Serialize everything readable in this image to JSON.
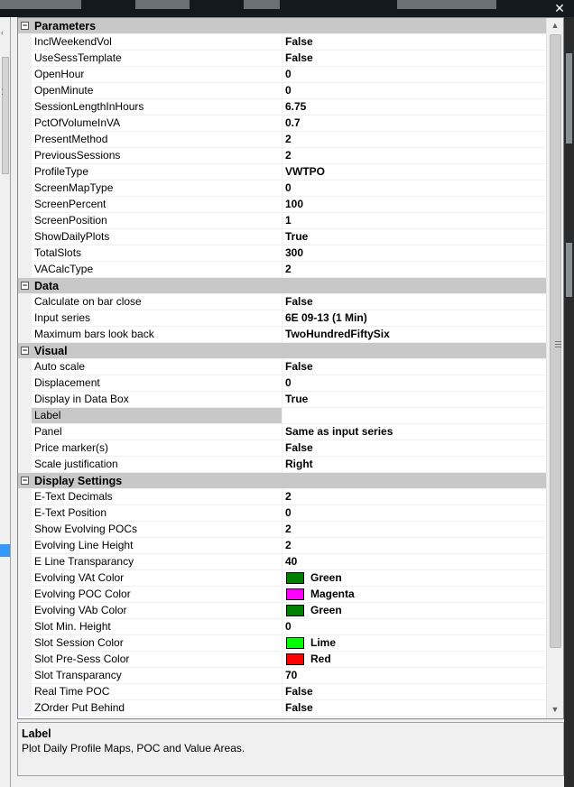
{
  "window": {
    "close_glyph": "✕"
  },
  "categories": [
    {
      "label": "Parameters",
      "toggle": "−",
      "props": [
        {
          "name": "InclWeekendVol",
          "value": "False"
        },
        {
          "name": "UseSessTemplate",
          "value": "False"
        },
        {
          "name": "OpenHour",
          "value": "0"
        },
        {
          "name": "OpenMinute",
          "value": "0"
        },
        {
          "name": "SessionLengthInHours",
          "value": "6.75"
        },
        {
          "name": "PctOfVolumeInVA",
          "value": "0.7"
        },
        {
          "name": "PresentMethod",
          "value": "2"
        },
        {
          "name": "PreviousSessions",
          "value": "2"
        },
        {
          "name": "ProfileType",
          "value": "VWTPO"
        },
        {
          "name": "ScreenMapType",
          "value": "0"
        },
        {
          "name": "ScreenPercent",
          "value": "100"
        },
        {
          "name": "ScreenPosition",
          "value": "1"
        },
        {
          "name": "ShowDailyPlots",
          "value": "True"
        },
        {
          "name": "TotalSlots",
          "value": "300"
        },
        {
          "name": "VACalcType",
          "value": "2"
        }
      ]
    },
    {
      "label": "Data",
      "toggle": "−",
      "props": [
        {
          "name": "Calculate on bar close",
          "value": "False"
        },
        {
          "name": "Input series",
          "value": "6E 09-13 (1 Min)"
        },
        {
          "name": "Maximum bars look back",
          "value": "TwoHundredFiftySix"
        }
      ]
    },
    {
      "label": "Visual",
      "toggle": "−",
      "props": [
        {
          "name": "Auto scale",
          "value": "False"
        },
        {
          "name": "Displacement",
          "value": "0"
        },
        {
          "name": "Display in Data Box",
          "value": "True"
        },
        {
          "name": "Label",
          "value": "",
          "selected": true
        },
        {
          "name": "Panel",
          "value": "Same as input series"
        },
        {
          "name": "Price marker(s)",
          "value": "False"
        },
        {
          "name": "Scale justification",
          "value": "Right"
        }
      ]
    },
    {
      "label": "Display Settings",
      "toggle": "−",
      "props": [
        {
          "name": "E-Text Decimals",
          "value": "2"
        },
        {
          "name": "E-Text Position",
          "value": "0"
        },
        {
          "name": "Show Evolving POCs",
          "value": "2"
        },
        {
          "name": "Evolving Line Height",
          "value": "2"
        },
        {
          "name": "E Line Transparancy",
          "value": "40"
        },
        {
          "name": "Evolving VAt Color",
          "value": "Green",
          "color": "#008000"
        },
        {
          "name": "Evolving POC Color",
          "value": "Magenta",
          "color": "#ff00ff"
        },
        {
          "name": "Evolving VAb Color",
          "value": "Green",
          "color": "#008000"
        },
        {
          "name": "Slot Min. Height",
          "value": "0"
        },
        {
          "name": "Slot Session Color",
          "value": "Lime",
          "color": "#00ff00"
        },
        {
          "name": "Slot Pre-Sess Color",
          "value": "Red",
          "color": "#ff0000"
        },
        {
          "name": "Slot Transparancy",
          "value": "70"
        },
        {
          "name": "Real Time POC",
          "value": "False"
        },
        {
          "name": "ZOrder Put Behind",
          "value": "False"
        }
      ]
    }
  ],
  "scrollbar": {
    "up_arrow": "▲",
    "down_arrow": "▼"
  },
  "description": {
    "title": "Label",
    "text": "Plot Daily Profile Maps, POC and Value Areas."
  }
}
